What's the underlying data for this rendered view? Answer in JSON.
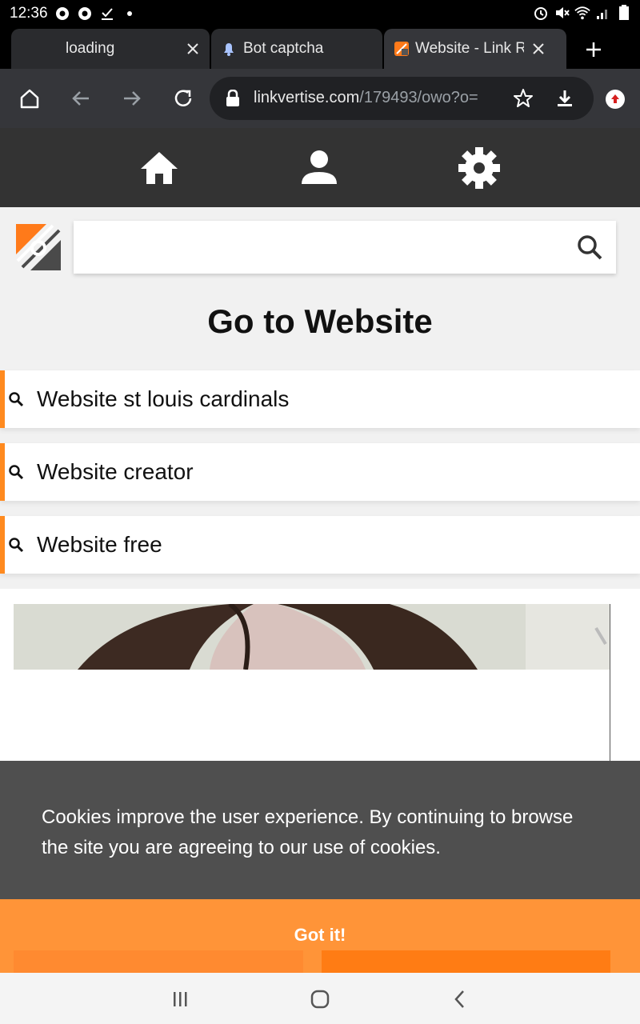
{
  "status_bar": {
    "time": "12:36"
  },
  "tabs": [
    {
      "title": "loading",
      "active": false
    },
    {
      "title": "Bot captcha",
      "active": false
    },
    {
      "title": "Website - Link Re",
      "active": true
    }
  ],
  "toolbar": {
    "url_host": "linkvertise.com",
    "url_path": "/179493/owo?o="
  },
  "page": {
    "heading": "Go to Website",
    "results": [
      {
        "label": "Website st louis cardinals"
      },
      {
        "label": "Website creator"
      },
      {
        "label": "Website free"
      }
    ]
  },
  "cookie_banner": {
    "message": "Cookies improve the user experience. By continuing to browse the site you are agreeing to our use of cookies.",
    "button_label": "Got it!"
  },
  "colors": {
    "accent_orange": "#ff8a1f",
    "gotit_orange": "#ff9438",
    "site_nav_bg": "#333333",
    "cookie_bg": "#4f4f4f"
  },
  "icons": [
    "home-icon",
    "user-icon",
    "gear-icon",
    "search-icon",
    "lock-icon",
    "star-icon",
    "download-icon",
    "reload-icon",
    "back-icon",
    "forward-icon",
    "close-icon",
    "plus-icon"
  ]
}
